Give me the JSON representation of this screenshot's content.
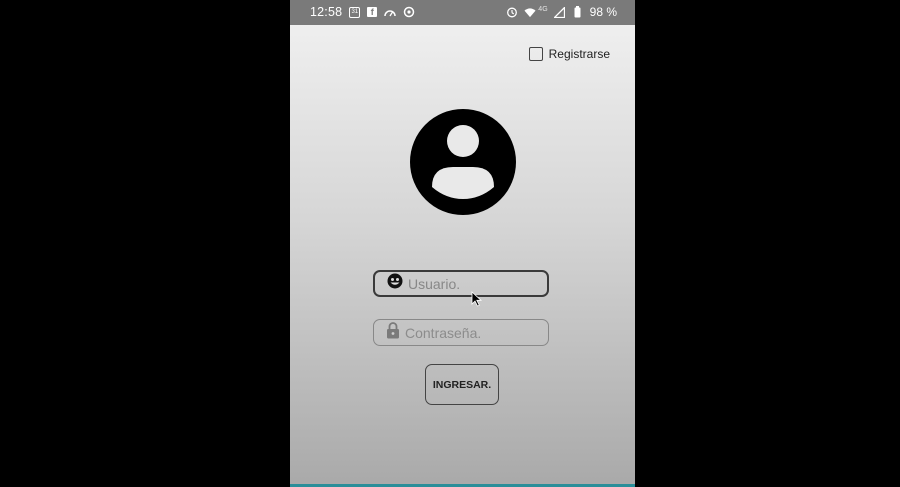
{
  "status_bar": {
    "time": "12:58",
    "left_icons": [
      "calendar-31-icon",
      "facebook-icon",
      "gauge-icon",
      "sync-icon"
    ],
    "calendar_day": "31",
    "network_label": "4G",
    "battery": "98 %"
  },
  "register": {
    "label": "Registrarse",
    "checked": false
  },
  "login": {
    "user_placeholder": "Usuario.",
    "password_placeholder": "Contraseña.",
    "submit_label": "INGRESAR."
  },
  "colors": {
    "accent_bottom": "#2a8e99",
    "status_bar": "#7a7a7a"
  }
}
